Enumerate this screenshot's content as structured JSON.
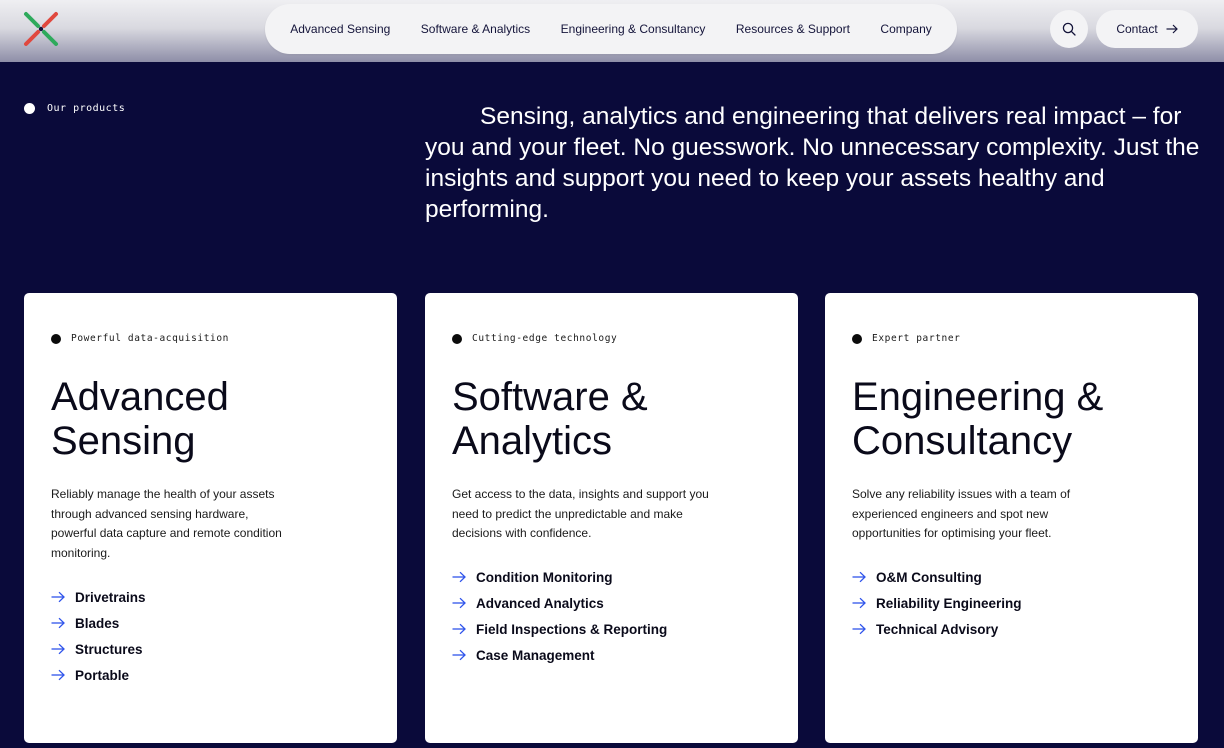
{
  "header": {
    "logo": "logo-x-mark",
    "nav_items": [
      {
        "label": "Advanced Sensing"
      },
      {
        "label": "Software & Analytics"
      },
      {
        "label": "Engineering & Consultancy"
      },
      {
        "label": "Resources & Support"
      },
      {
        "label": "Company"
      }
    ],
    "search_icon": "search-icon",
    "contact_label": "Contact"
  },
  "hero": {
    "eyebrow": "Our products",
    "intro": "Sensing, analytics and engineering that delivers real impact – for you and your fleet. No guesswork. No unnecessary complexity. Just the insights and support you need to keep your assets healthy and performing."
  },
  "cards": [
    {
      "tag": "Powerful data-acquisition",
      "title": "Advanced Sensing",
      "description": "Reliably manage the health of your assets through advanced sensing hardware, powerful data capture and remote condition monitoring.",
      "items": [
        "Drivetrains",
        "Blades",
        "Structures",
        "Portable"
      ]
    },
    {
      "tag": "Cutting-edge technology",
      "title": "Software & Analytics",
      "description": "Get access to the data, insights and support you need to predict the unpredictable and make decisions with confidence.",
      "items": [
        "Condition Monitoring",
        "Advanced Analytics",
        "Field Inspections & Reporting",
        "Case Management"
      ]
    },
    {
      "tag": "Expert partner",
      "title": "Engineering & Consultancy",
      "description": "Solve any reliability issues with a team of experienced engineers and spot new opportunities for optimising your fleet.",
      "items": [
        "O&M Consulting",
        "Reliability Engineering",
        "Technical Advisory"
      ]
    }
  ],
  "colors": {
    "background": "#0a0a3a",
    "accent_arrow": "#2f54eb",
    "logo_red": "#e0483e",
    "logo_green": "#2eaa5c"
  }
}
